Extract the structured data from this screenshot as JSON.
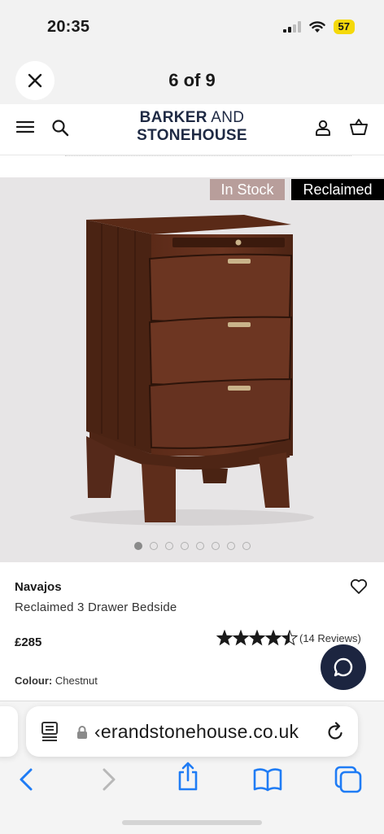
{
  "status_bar": {
    "time": "20:35",
    "battery": "57"
  },
  "gallery": {
    "counter": "6 of 9",
    "dots_total": 8,
    "active_dot_index": 0
  },
  "site": {
    "logo_line1_bold": "BARKER",
    "logo_line1_rest": " AND",
    "logo_line2": "STONEHOUSE"
  },
  "badges": {
    "stock": "In Stock",
    "reclaimed": "Reclaimed"
  },
  "product": {
    "brand": "Navajos",
    "name": "Reclaimed 3 Drawer Bedside",
    "price": "£285",
    "rating": 4.5,
    "reviews": "(14 Reviews)",
    "colour_label": "Colour:",
    "colour_value": "Chestnut"
  },
  "browser": {
    "url": "‹erandstonehouse.co.uk"
  },
  "colors": {
    "navy": "#1f2a44",
    "stock_badge": "#b89e9b",
    "safari_blue": "#1f7cf5"
  },
  "icons": [
    "close-icon",
    "menu-icon",
    "search-icon",
    "account-icon",
    "basket-icon",
    "heart-icon",
    "star-icon",
    "chat-icon",
    "reader-icon",
    "lock-icon",
    "reload-icon",
    "back-icon",
    "forward-icon",
    "share-icon",
    "bookmarks-icon",
    "tabs-icon"
  ]
}
